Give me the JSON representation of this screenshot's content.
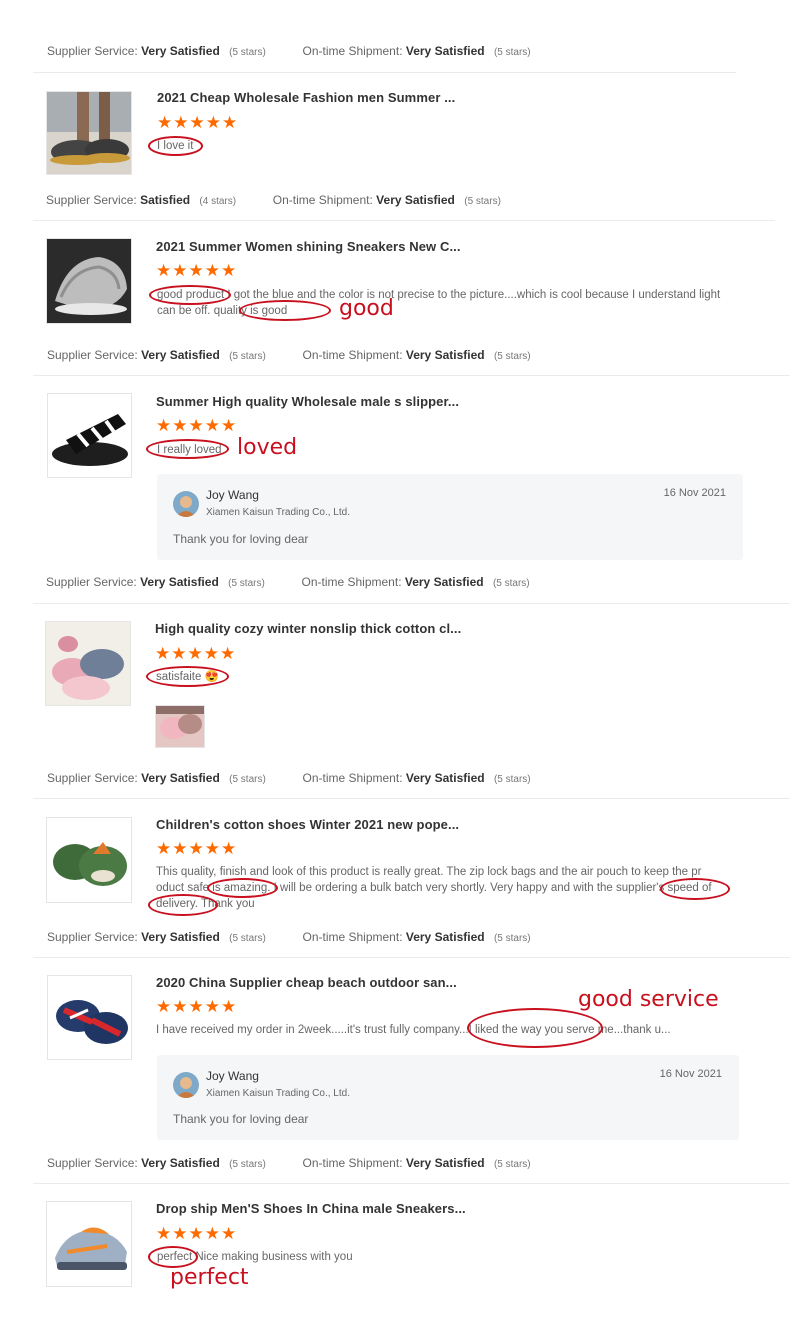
{
  "labels": {
    "supplier_service": "Supplier Service:",
    "ontime_shipment": "On-time Shipment:"
  },
  "ratings": [
    {
      "supplier_value": "Very Satisfied",
      "supplier_stars": "(5 stars)",
      "shipment_value": "Very Satisfied",
      "shipment_stars": "(5 stars)"
    },
    {
      "supplier_value": "Satisfied",
      "supplier_stars": "(4 stars)",
      "shipment_value": "Very Satisfied",
      "shipment_stars": "(5 stars)"
    },
    {
      "supplier_value": "Very Satisfied",
      "supplier_stars": "(5 stars)",
      "shipment_value": "Very Satisfied",
      "shipment_stars": "(5 stars)"
    },
    {
      "supplier_value": "Very Satisfied",
      "supplier_stars": "(5 stars)",
      "shipment_value": "Very Satisfied",
      "shipment_stars": "(5 stars)"
    },
    {
      "supplier_value": "Very Satisfied",
      "supplier_stars": "(5 stars)",
      "shipment_value": "Very Satisfied",
      "shipment_stars": "(5 stars)"
    },
    {
      "supplier_value": "Very Satisfied",
      "supplier_stars": "(5 stars)",
      "shipment_value": "Very Satisfied",
      "shipment_stars": "(5 stars)"
    },
    {
      "supplier_value": "Very Satisfied",
      "supplier_stars": "(5 stars)",
      "shipment_value": "Very Satisfied",
      "shipment_stars": "(5 stars)"
    }
  ],
  "stars": "★★★★★",
  "reviews": [
    {
      "title": "2021 Cheap Wholesale Fashion men Summer ...",
      "text": "I love it"
    },
    {
      "title": "2021 Summer Women shining Sneakers New C...",
      "text": "good product I got the blue and the color is not precise to the picture....which is cool because I understand light can be off. quality is good"
    },
    {
      "title": "Summer High quality Wholesale male s slipper...",
      "text": "I really loved"
    },
    {
      "title": "High quality cozy winter nonslip thick cotton cl...",
      "text": "satisfaite 😍"
    },
    {
      "title": "Children's cotton shoes Winter 2021 new pope...",
      "text": "This quality, finish and look of this product is really great. The zip lock bags and the air pouch to keep the pr oduct safe is amazing. I will be ordering a bulk batch very shortly. Very happy and with the supplier's speed of delivery. Thank you"
    },
    {
      "title": "2020 China Supplier cheap beach outdoor san...",
      "text": "I have received my order in 2week.....it's trust fully company...I liked the way you serve me...thank u..."
    },
    {
      "title": "Drop ship Men'S Shoes In China male Sneakers...",
      "text": "perfect Nice making business with you"
    }
  ],
  "replies": [
    {
      "name": "Joy Wang",
      "company": "Xiamen Kaisun Trading Co., Ltd.",
      "date": "16 Nov 2021",
      "text": "Thank you for loving dear"
    },
    {
      "name": "Joy Wang",
      "company": "Xiamen Kaisun Trading Co., Ltd.",
      "date": "16 Nov 2021",
      "text": "Thank you for loving dear"
    }
  ],
  "annotations": {
    "good": "good",
    "loved": "loved",
    "good_service": "good service",
    "perfect": "perfect"
  },
  "colors": {
    "star": "#ff6a00",
    "annotation": "#c8101e",
    "reply_bg": "#f5f6f8"
  }
}
